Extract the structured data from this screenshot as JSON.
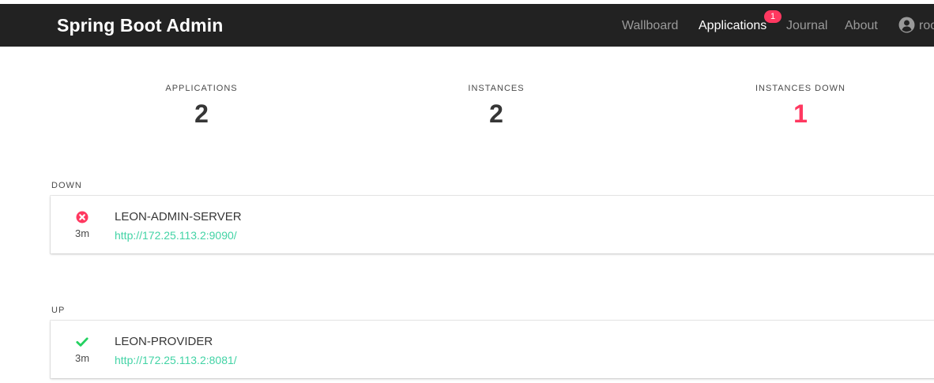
{
  "brand": "Spring Boot Admin",
  "nav": {
    "wallboard": "Wallboard",
    "applications": "Applications",
    "applications_badge": "1",
    "journal": "Journal",
    "about": "About",
    "user": "roo",
    "user_icon": "user-circle-icon"
  },
  "stats": {
    "applications": {
      "heading": "APPLICATIONS",
      "value": "2"
    },
    "instances": {
      "heading": "INSTANCES",
      "value": "2"
    },
    "instances_down": {
      "heading": "INSTANCES DOWN",
      "value": "1"
    }
  },
  "groups": {
    "down": {
      "label": "DOWN",
      "status_icon": "x-circle-icon",
      "time": "3m",
      "name": "LEON-ADMIN-SERVER",
      "url": "http://172.25.113.2:9090/"
    },
    "up": {
      "label": "UP",
      "status_icon": "check-icon",
      "time": "3m",
      "name": "LEON-PROVIDER",
      "url": "http://172.25.113.2:8081/"
    }
  },
  "colors": {
    "navbar": "#222222",
    "danger": "#ff3860",
    "success": "#23d160",
    "link": "#42d3a5"
  }
}
